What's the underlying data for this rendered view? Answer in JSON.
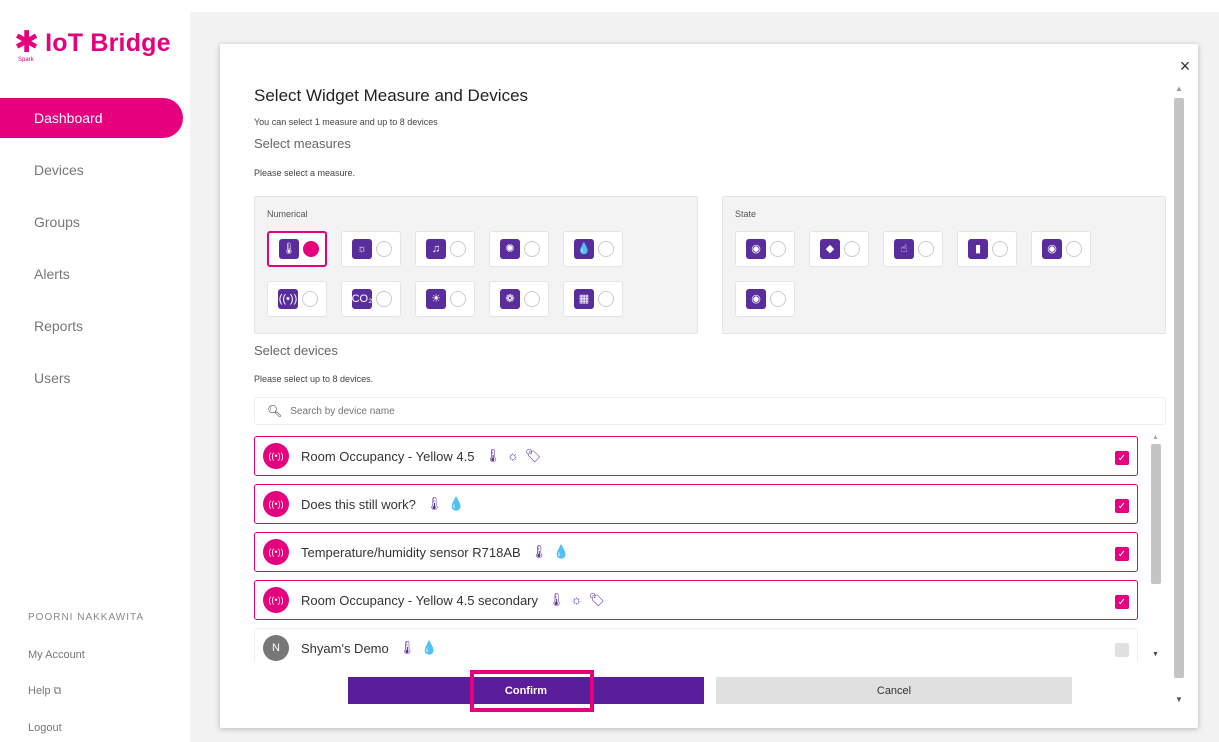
{
  "app": {
    "logo_text": "IoT Bridge",
    "logo_sub": "Spark"
  },
  "sidebar": {
    "items": [
      {
        "label": "Dashboard",
        "active": true
      },
      {
        "label": "Devices"
      },
      {
        "label": "Groups"
      },
      {
        "label": "Alerts"
      },
      {
        "label": "Reports"
      },
      {
        "label": "Users"
      }
    ],
    "user_name": "POORNI NAKKAWITA",
    "links": [
      "My Account",
      "Help ⧉",
      "Logout"
    ]
  },
  "modal": {
    "title": "Select Widget Measure and Devices",
    "subtitle": "You can select 1 measure and up to 8 devices",
    "close_label": "×",
    "measures_label": "Select measures",
    "measures_hint": "Please select a measure.",
    "numerical_label": "Numerical",
    "state_label": "State",
    "numerical_icons": [
      "thermometer-icon",
      "light-icon",
      "sound-icon",
      "brightness-icon",
      "humidity-icon",
      "occupancy-icon",
      "co2-icon",
      "lux-icon",
      "air-quality-icon",
      "pressure-icon"
    ],
    "state_icons": [
      "toggle-icon",
      "tag-icon",
      "touch-icon",
      "door-icon",
      "switch-icon",
      "toggle-alt-icon"
    ],
    "selected_measure": "thermometer-icon",
    "devices_label": "Select devices",
    "devices_hint": "Please select up to 8 devices.",
    "search_placeholder": "Search by device name",
    "devices": [
      {
        "name": "Room Occupancy - Yellow 4.5",
        "icons": [
          "🌡",
          "☼",
          "🏷"
        ],
        "checked": true
      },
      {
        "name": "Does this still work?",
        "icons": [
          "🌡",
          "💧"
        ],
        "checked": true
      },
      {
        "name": "Temperature/humidity sensor R718AB",
        "icons": [
          "🌡",
          "💧"
        ],
        "checked": true
      },
      {
        "name": "Room Occupancy - Yellow 4.5 secondary",
        "icons": [
          "🌡",
          "☼",
          "🏷"
        ],
        "checked": true
      },
      {
        "name": "Shyam's Demo",
        "icons": [
          "🌡",
          "💧"
        ],
        "checked": false
      }
    ],
    "confirm_label": "Confirm",
    "cancel_label": "Cancel"
  },
  "colors": {
    "brand_pink": "#e6007e",
    "brand_purple": "#5a1e9b",
    "icon_purple": "#5a2d9c"
  }
}
